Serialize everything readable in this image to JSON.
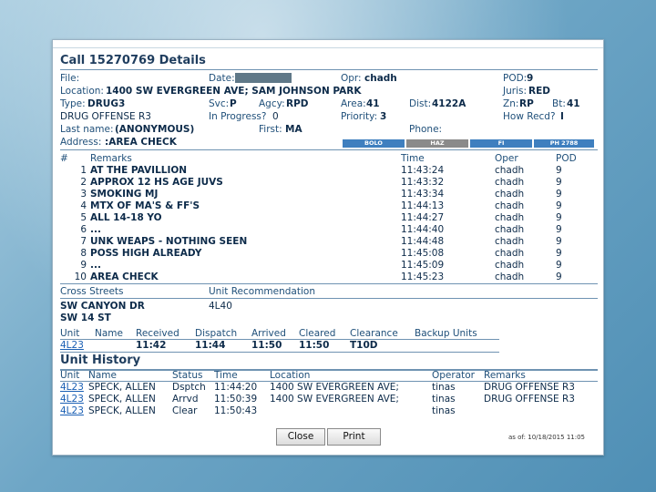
{
  "dialog": {
    "title": "Call 15270769 Details"
  },
  "fields": {
    "file_label": "File:",
    "date_label": "Date:",
    "opr_label": "Opr:",
    "opr_value": "chadh",
    "pod_label": "POD:",
    "pod_value": "9",
    "location_label": "Location:",
    "location_value": "1400 SW EVERGREEN AVE; SAM JOHNSON PARK",
    "juris_label": "Juris:",
    "juris_value": "RED",
    "type_label": "Type:",
    "type_value": "DRUG3",
    "svc_label": "Svc:",
    "svc_value": "P",
    "agcy_label": "Agcy:",
    "agcy_value": "RPD",
    "area_label": "Area:",
    "area_value": "41",
    "dist_label": "Dist:",
    "dist_value": "4122A",
    "zn_label": "Zn:",
    "zn_value": "RP",
    "bt_label": "Bt:",
    "bt_value": "41",
    "type_desc": "DRUG OFFENSE R3",
    "inprogress_label": "In Progress?",
    "inprogress_value": "0",
    "priority_label": "Priority:",
    "priority_value": "3",
    "howrecd_label": "How Recd?",
    "howrecd_value": "I",
    "lastname_label": "Last name:",
    "lastname_value": "(ANONYMOUS)",
    "first_label": "First:",
    "first_value": "MA",
    "phone_label": "Phone:",
    "address_label": "Address:",
    "address_value": ":AREA CHECK"
  },
  "flags": [
    "BOLO",
    "HAZ",
    "FI",
    "PH 2788"
  ],
  "remarks": {
    "headers": {
      "num": "#",
      "remarks": "Remarks",
      "time": "Time",
      "oper": "Oper",
      "pod": "POD"
    },
    "rows": [
      {
        "num": "1",
        "text": "AT THE PAVILLION",
        "time": "11:43:24",
        "oper": "chadh",
        "pod": "9"
      },
      {
        "num": "2",
        "text": "APPROX 12 HS AGE JUVS",
        "time": "11:43:32",
        "oper": "chadh",
        "pod": "9"
      },
      {
        "num": "3",
        "text": "SMOKING MJ",
        "time": "11:43:34",
        "oper": "chadh",
        "pod": "9"
      },
      {
        "num": "4",
        "text": "MTX OF MA'S & FF'S",
        "time": "11:44:13",
        "oper": "chadh",
        "pod": "9"
      },
      {
        "num": "5",
        "text": "ALL 14-18 YO",
        "time": "11:44:27",
        "oper": "chadh",
        "pod": "9"
      },
      {
        "num": "6",
        "text": "...",
        "time": "11:44:40",
        "oper": "chadh",
        "pod": "9"
      },
      {
        "num": "7",
        "text": "UNK WEAPS - NOTHING SEEN",
        "time": "11:44:48",
        "oper": "chadh",
        "pod": "9"
      },
      {
        "num": "8",
        "text": "POSS HIGH ALREADY",
        "time": "11:45:08",
        "oper": "chadh",
        "pod": "9"
      },
      {
        "num": "9",
        "text": "...",
        "time": "11:45:09",
        "oper": "chadh",
        "pod": "9"
      },
      {
        "num": "10",
        "text": "AREA CHECK",
        "time": "11:45:23",
        "oper": "chadh",
        "pod": "9"
      }
    ]
  },
  "cross": {
    "label": "Cross Streets",
    "streets": [
      "SW CANYON DR",
      "SW 14 ST"
    ],
    "rec_label": "Unit Recommendation",
    "rec_value": "4L40"
  },
  "units": {
    "headers": {
      "unit": "Unit",
      "name": "Name",
      "received": "Received",
      "dispatch": "Dispatch",
      "arrived": "Arrived",
      "cleared": "Cleared",
      "clearance": "Clearance",
      "backup": "Backup Units"
    },
    "rows": [
      {
        "unit": "4L23",
        "name": "",
        "received": "11:42",
        "dispatch": "11:44",
        "arrived": "11:50",
        "cleared": "11:50",
        "clearance": "T10D"
      }
    ]
  },
  "history": {
    "title": "Unit History",
    "headers": {
      "unit": "Unit",
      "name": "Name",
      "status": "Status",
      "time": "Time",
      "location": "Location",
      "operator": "Operator",
      "remarks": "Remarks"
    },
    "rows": [
      {
        "unit": "4L23",
        "name": "SPECK, ALLEN",
        "status": "Dsptch",
        "time": "11:44:20",
        "location": "1400 SW EVERGREEN AVE;",
        "operator": "tinas",
        "remarks": "DRUG OFFENSE R3"
      },
      {
        "unit": "4L23",
        "name": "SPECK, ALLEN",
        "status": "Arrvd",
        "time": "11:50:39",
        "location": "1400 SW EVERGREEN AVE;",
        "operator": "tinas",
        "remarks": "DRUG OFFENSE R3"
      },
      {
        "unit": "4L23",
        "name": "SPECK, ALLEN",
        "status": "Clear",
        "time": "11:50:43",
        "location": "",
        "operator": "tinas",
        "remarks": ""
      }
    ]
  },
  "buttons": {
    "close": "Close",
    "print": "Print"
  },
  "footer": {
    "as_of": "as of: 10/18/2015 11:05"
  },
  "colors": {
    "background": "#6ea6c6",
    "flag_blue": "#3f7fbf",
    "flag_gray": "#8a8a8a",
    "link": "#1a5fb4"
  }
}
